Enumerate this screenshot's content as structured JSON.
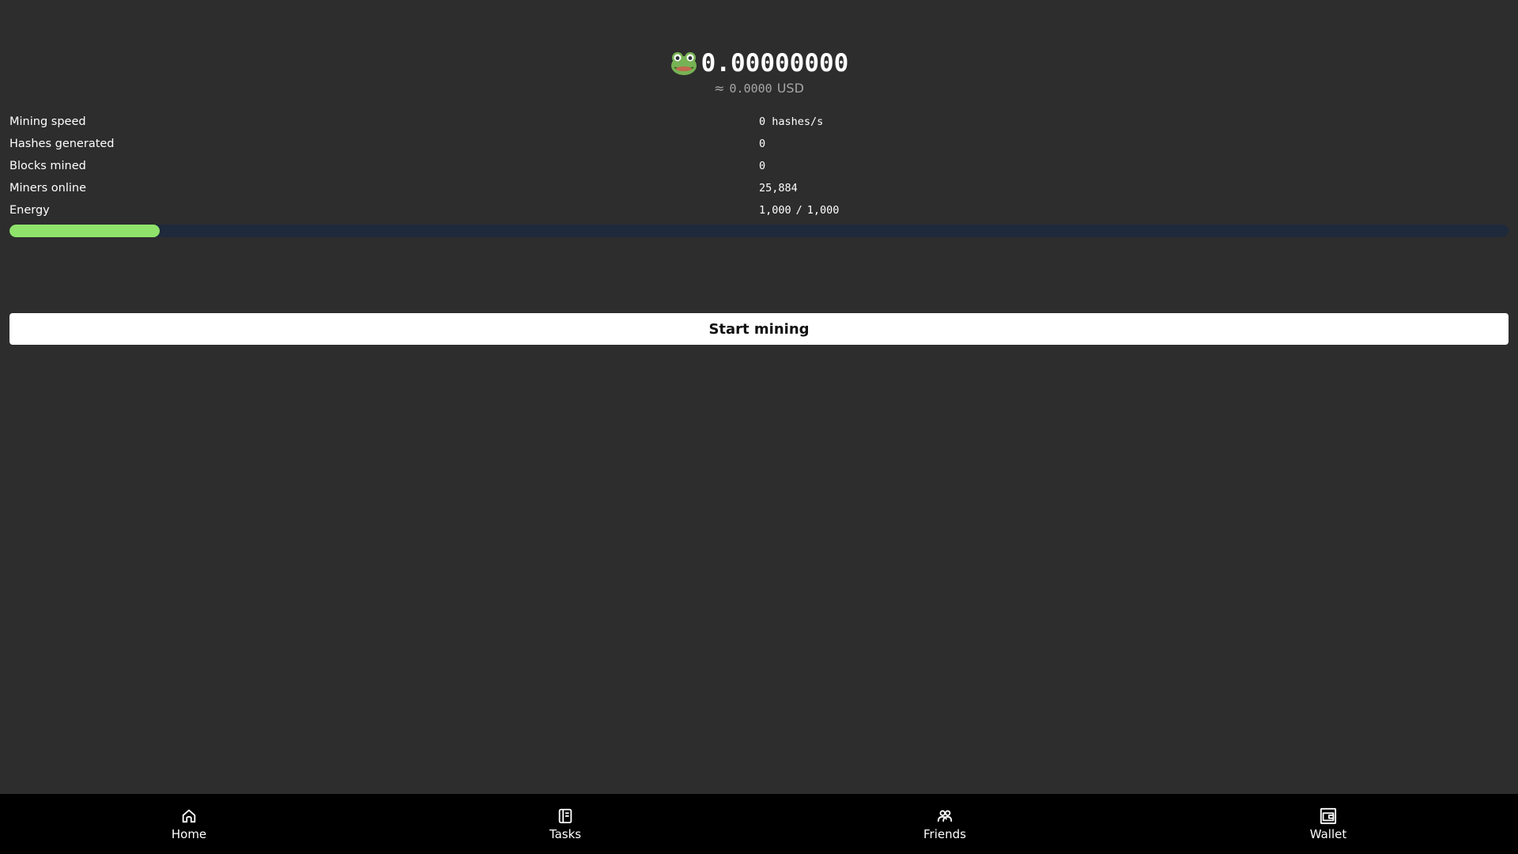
{
  "balance": {
    "icon": "frog-icon",
    "amount": "0.00000000",
    "approx_symbol": "≈",
    "usd_value": "0.0000",
    "usd_label": "USD"
  },
  "stats": [
    {
      "label": "Mining speed",
      "value": "0 hashes/s"
    },
    {
      "label": "Hashes generated",
      "value": "0"
    },
    {
      "label": "Blocks mined",
      "value": "0"
    },
    {
      "label": "Miners online",
      "value": "25,884"
    }
  ],
  "energy": {
    "label": "Energy",
    "current": "1,000",
    "separator": "/",
    "max": "1,000",
    "bar_fill_fraction": 0.1,
    "bar_color": "#8fe36b",
    "track_color": "#1e293b"
  },
  "start_button": {
    "label": "Start mining"
  },
  "nav": [
    {
      "label": "Home",
      "icon": "home-icon"
    },
    {
      "label": "Tasks",
      "icon": "tasks-icon"
    },
    {
      "label": "Friends",
      "icon": "friends-icon"
    },
    {
      "label": "Wallet",
      "icon": "wallet-icon"
    }
  ]
}
